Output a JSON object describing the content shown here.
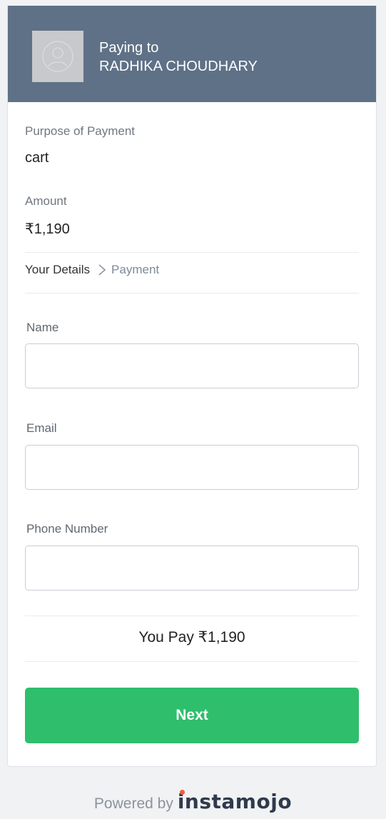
{
  "header": {
    "paying_to_label": "Paying to",
    "payee_name": "RADHIKA CHOUDHARY"
  },
  "details": {
    "purpose_label": "Purpose of Payment",
    "purpose_value": "cart",
    "amount_label": "Amount",
    "amount_value": "₹1,190"
  },
  "steps": {
    "current": "Your Details",
    "next": "Payment"
  },
  "form": {
    "name_label": "Name",
    "name_value": "",
    "email_label": "Email",
    "email_value": "",
    "phone_label": "Phone Number",
    "phone_value": ""
  },
  "summary": {
    "you_pay": "You Pay ₹1,190"
  },
  "actions": {
    "next_label": "Next"
  },
  "footer": {
    "powered_by": "Powered by",
    "brand": "instamojo"
  },
  "colors": {
    "header_bg": "#5f7186",
    "button_bg": "#2fbe6c",
    "brand_accent": "#f25b3f"
  },
  "icons": {
    "avatar": "user-avatar-icon",
    "step_separator": "chevron-right-icon"
  }
}
